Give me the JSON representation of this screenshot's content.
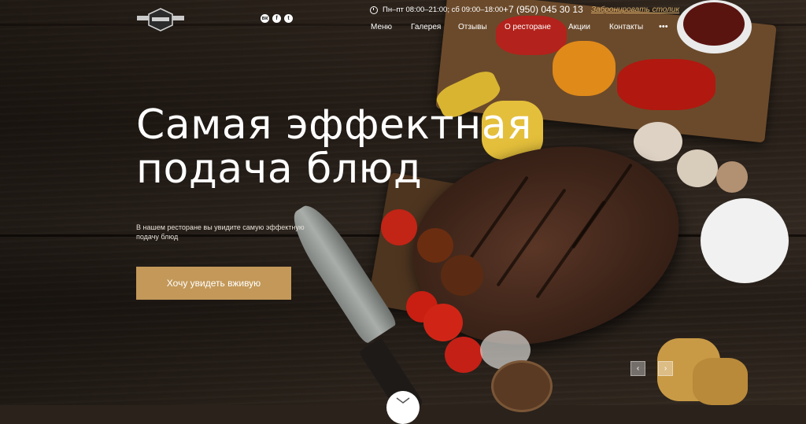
{
  "header": {
    "logo_name": "logo-badge",
    "socials": [
      {
        "icon": "vk-icon",
        "glyph": "вк"
      },
      {
        "icon": "facebook-icon",
        "glyph": "f"
      },
      {
        "icon": "twitter-icon",
        "glyph": "t"
      }
    ],
    "hours": "Пн–пт 08:00–21:00; сб 09:00–18:00",
    "phone": "+7 (950) 045 30 13",
    "reserve_link": "Забронировать столик",
    "nav": [
      "Меню",
      "Галерея",
      "Отзывы",
      "О ресторане",
      "Акции",
      "Контакты"
    ],
    "more_glyph": "•••"
  },
  "hero": {
    "title": "Самая эффектная\nподача блюд",
    "subtitle": "В нашем ресторане вы увидите самую эффектную подачу блюд",
    "cta_label": "Хочу увидеть вживую",
    "prev_glyph": "‹",
    "next_glyph": "›"
  },
  "colors": {
    "accent": "#c39858",
    "link": "#d4ad6c"
  }
}
